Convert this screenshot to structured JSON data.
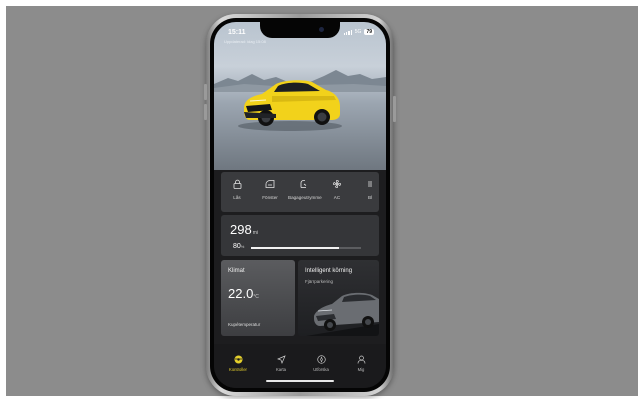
{
  "status_bar": {
    "time": "15:11",
    "network": "5G",
    "battery": "79",
    "subline": "Uppdaterad: idag 15:08"
  },
  "hero": {
    "vehicle_color": "#f2d21b",
    "image": "yellow-suv-car"
  },
  "quick_controls": [
    {
      "icon": "lock-icon",
      "label": "Lås"
    },
    {
      "icon": "window-icon",
      "label": "Fönster"
    },
    {
      "icon": "trunk-icon",
      "label": "Bagageutrymme"
    },
    {
      "icon": "fan-icon",
      "label": "AC"
    },
    {
      "icon": "lights-icon",
      "label": "Bl"
    }
  ],
  "range": {
    "value": "298",
    "unit": "mi",
    "battery_percent": "80",
    "battery_unit": "%",
    "battery_level": 0.8
  },
  "climate": {
    "title": "Klimat",
    "temperature": "22.0",
    "unit": "°C",
    "subtitle": "Kupétemperatur"
  },
  "driving": {
    "title": "Intelligent körning",
    "subtitle": "Fjärrparkering"
  },
  "tabs": [
    {
      "icon": "steering-wheel-icon",
      "label": "Kontroller",
      "active": true
    },
    {
      "icon": "navigation-icon",
      "label": "Karta",
      "active": false
    },
    {
      "icon": "explore-icon",
      "label": "Utforska",
      "active": false
    },
    {
      "icon": "person-icon",
      "label": "Mig",
      "active": false
    }
  ],
  "colors": {
    "accent": "#e5d02c",
    "card": "#353639",
    "screen_bg": "#1d1d1f",
    "backdrop": "#8c8c8c"
  }
}
